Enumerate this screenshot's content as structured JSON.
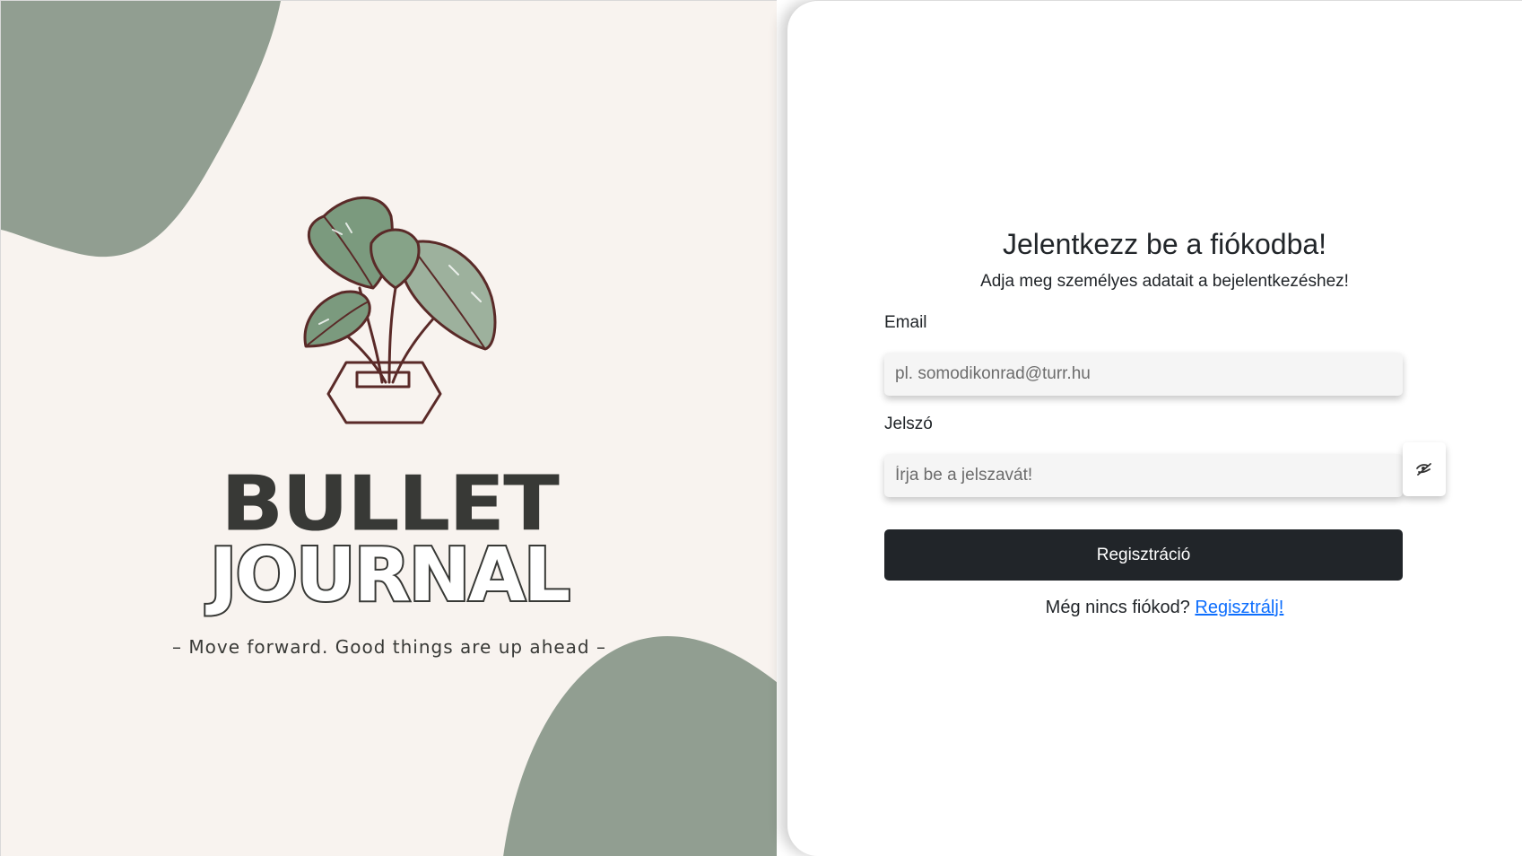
{
  "brand": {
    "title": "BULLET",
    "subtitle": "JOURNAL",
    "tagline": "– Move forward. Good things are up ahead –",
    "colors": {
      "background": "#f8f3ef",
      "blob": "#919e91",
      "ink": "#383936",
      "leaf": "#7b9a7e"
    }
  },
  "login": {
    "title": "Jelentkezz be a fiókodba!",
    "subtitle": "Adja meg személyes adatait a bejelentkezéshez!",
    "email_label": "Email",
    "email_placeholder": "pl. somodikonrad@turr.hu",
    "email_value": "",
    "password_label": "Jelszó",
    "password_placeholder": "Írja be a jelszavát!",
    "password_value": "",
    "password_toggle_icon": "eye-slash-icon",
    "submit_label": "Regisztráció",
    "register_prompt": "Még nincs fiókod?",
    "register_link": "Regisztrálj!",
    "colors": {
      "button": "#212529",
      "link": "#0d6efd",
      "input_bg": "#f5f5f5"
    }
  }
}
